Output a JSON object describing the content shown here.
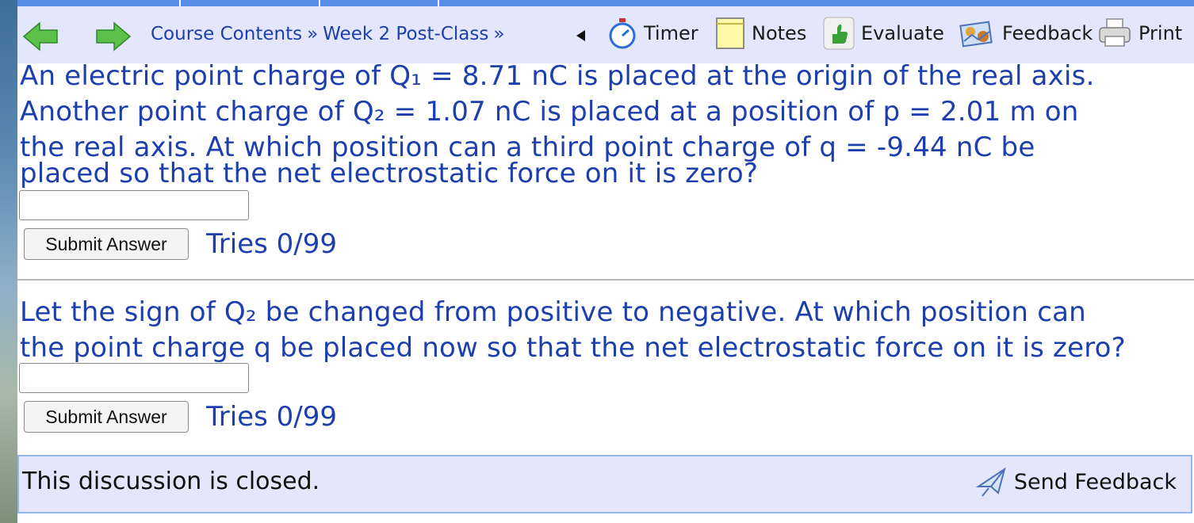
{
  "nav": {
    "breadcrumb": [
      "Course Contents",
      "Week 2 Post-Class"
    ],
    "tools": {
      "timer": "Timer",
      "notes": "Notes",
      "evaluate": "Evaluate",
      "feedback": "Feedback",
      "print": "Print"
    }
  },
  "question1": {
    "line1": "An electric point charge of Q₁ = 8.71 nC is placed at the origin of the real axis.",
    "line2": "Another point charge of Q₂ = 1.07 nC is placed at a position of p = 2.01 m on",
    "line3": "the real axis. At which position can a third point charge of q = -9.44 nC be",
    "line4": "placed so that the net electrostatic force on it is zero?",
    "answer_value": "",
    "submit_label": "Submit Answer",
    "tries": "Tries 0/99"
  },
  "question2": {
    "line1": "Let the sign of Q₂ be changed from positive to negative. At which position can",
    "line2": "the point charge q be placed now so that the net electrostatic force on it is zero?",
    "answer_value": "",
    "submit_label": "Submit Answer",
    "tries": "Tries 0/99"
  },
  "discussion": {
    "status": "This discussion is closed.",
    "send_feedback": "Send Feedback"
  },
  "colors": {
    "link_blue": "#1d3fae",
    "nav_bg": "#e4e6fb",
    "arrow_green": "#5cc04a"
  },
  "icons": [
    "back-arrow-icon",
    "forward-arrow-icon",
    "collapse-triangle-icon",
    "stopwatch-icon",
    "notepad-icon",
    "thumbs-up-icon",
    "feedback-mail-icon",
    "printer-icon",
    "send-feedback-icon"
  ]
}
